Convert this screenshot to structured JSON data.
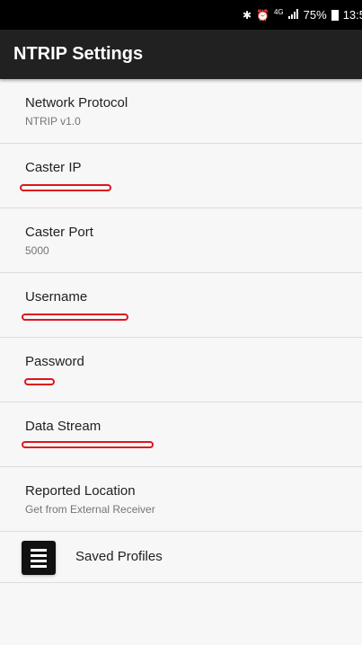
{
  "status_bar": {
    "bluetooth_icon": "bluetooth-icon",
    "alarm_icon": "alarm-icon",
    "network": "4G",
    "signal_icon": "signal-icon",
    "battery_percent": "75%",
    "battery_icon": "battery-icon",
    "time": "13:5"
  },
  "app_bar": {
    "title": "NTRIP Settings"
  },
  "settings": {
    "network_protocol": {
      "title": "Network Protocol",
      "summary": "NTRIP v1.0"
    },
    "caster_ip": {
      "title": "Caster IP"
    },
    "caster_port": {
      "title": "Caster Port",
      "summary": "5000"
    },
    "username": {
      "title": "Username"
    },
    "password": {
      "title": "Password"
    },
    "data_stream": {
      "title": "Data Stream"
    },
    "reported_location": {
      "title": "Reported Location",
      "summary": "Get from External Receiver"
    }
  },
  "saved_profiles": {
    "label": "Saved Profiles",
    "icon": "list-menu-icon"
  },
  "colors": {
    "status_bar_bg": "#000000",
    "app_bar_bg": "#212121",
    "background": "#f7f7f7",
    "redaction_mark": "#e0141e"
  }
}
